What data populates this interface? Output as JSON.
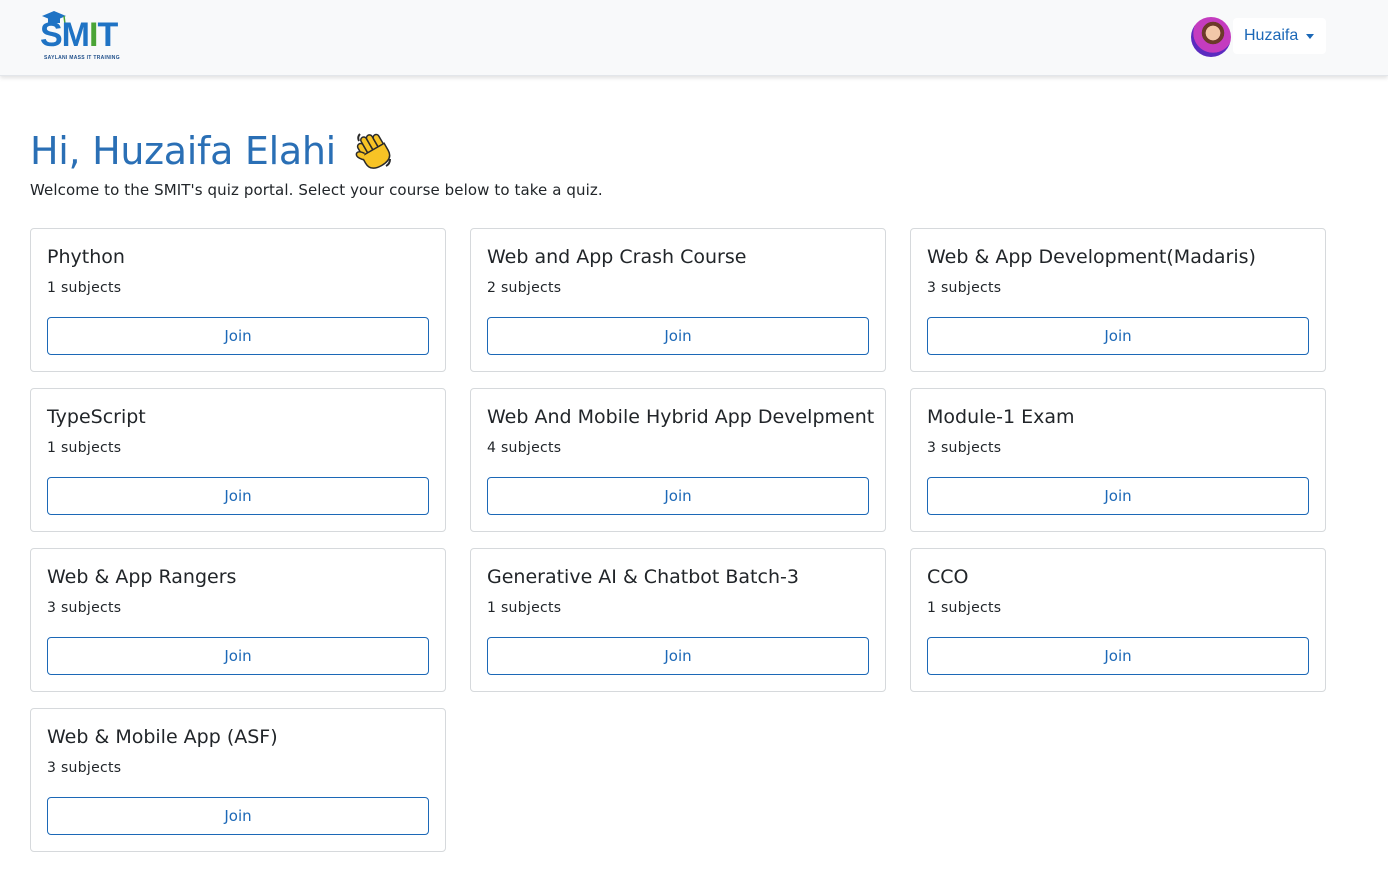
{
  "header": {
    "logo_text_start": "SM",
    "logo_text_i": "I",
    "logo_text_end": "T",
    "logo_subtitle": "SAYLANI MASS IT TRAINING",
    "user_name": "Huzaifa"
  },
  "main": {
    "greeting": "Hi, Huzaifa Elahi",
    "welcome": "Welcome to the SMIT's quiz portal. Select your course below to take a quiz.",
    "courses": [
      {
        "title": "Phython",
        "subjects": "1 subjects",
        "button": "Join"
      },
      {
        "title": "Web and App Crash Course",
        "subjects": "2 subjects",
        "button": "Join"
      },
      {
        "title": "Web & App Development(Madaris)",
        "subjects": "3 subjects",
        "button": "Join"
      },
      {
        "title": "TypeScript",
        "subjects": "1 subjects",
        "button": "Join"
      },
      {
        "title": "Web And Mobile Hybrid App Develpment",
        "subjects": "4 subjects",
        "button": "Join"
      },
      {
        "title": "Module-1 Exam",
        "subjects": "3 subjects",
        "button": "Join"
      },
      {
        "title": "Web & App Rangers",
        "subjects": "3 subjects",
        "button": "Join"
      },
      {
        "title": "Generative AI & Chatbot Batch-3",
        "subjects": "1 subjects",
        "button": "Join"
      },
      {
        "title": "CCO",
        "subjects": "1 subjects",
        "button": "Join"
      },
      {
        "title": "Web & Mobile App (ASF)",
        "subjects": "3 subjects",
        "button": "Join"
      }
    ]
  },
  "colors": {
    "accent": "#1c68b7",
    "greeting": "#2a6fb5",
    "logo_blue": "#1f73c4",
    "logo_green": "#4aa436"
  },
  "icons": [
    "graduation-cap-icon",
    "waving-hand-icon",
    "caret-down-icon"
  ]
}
